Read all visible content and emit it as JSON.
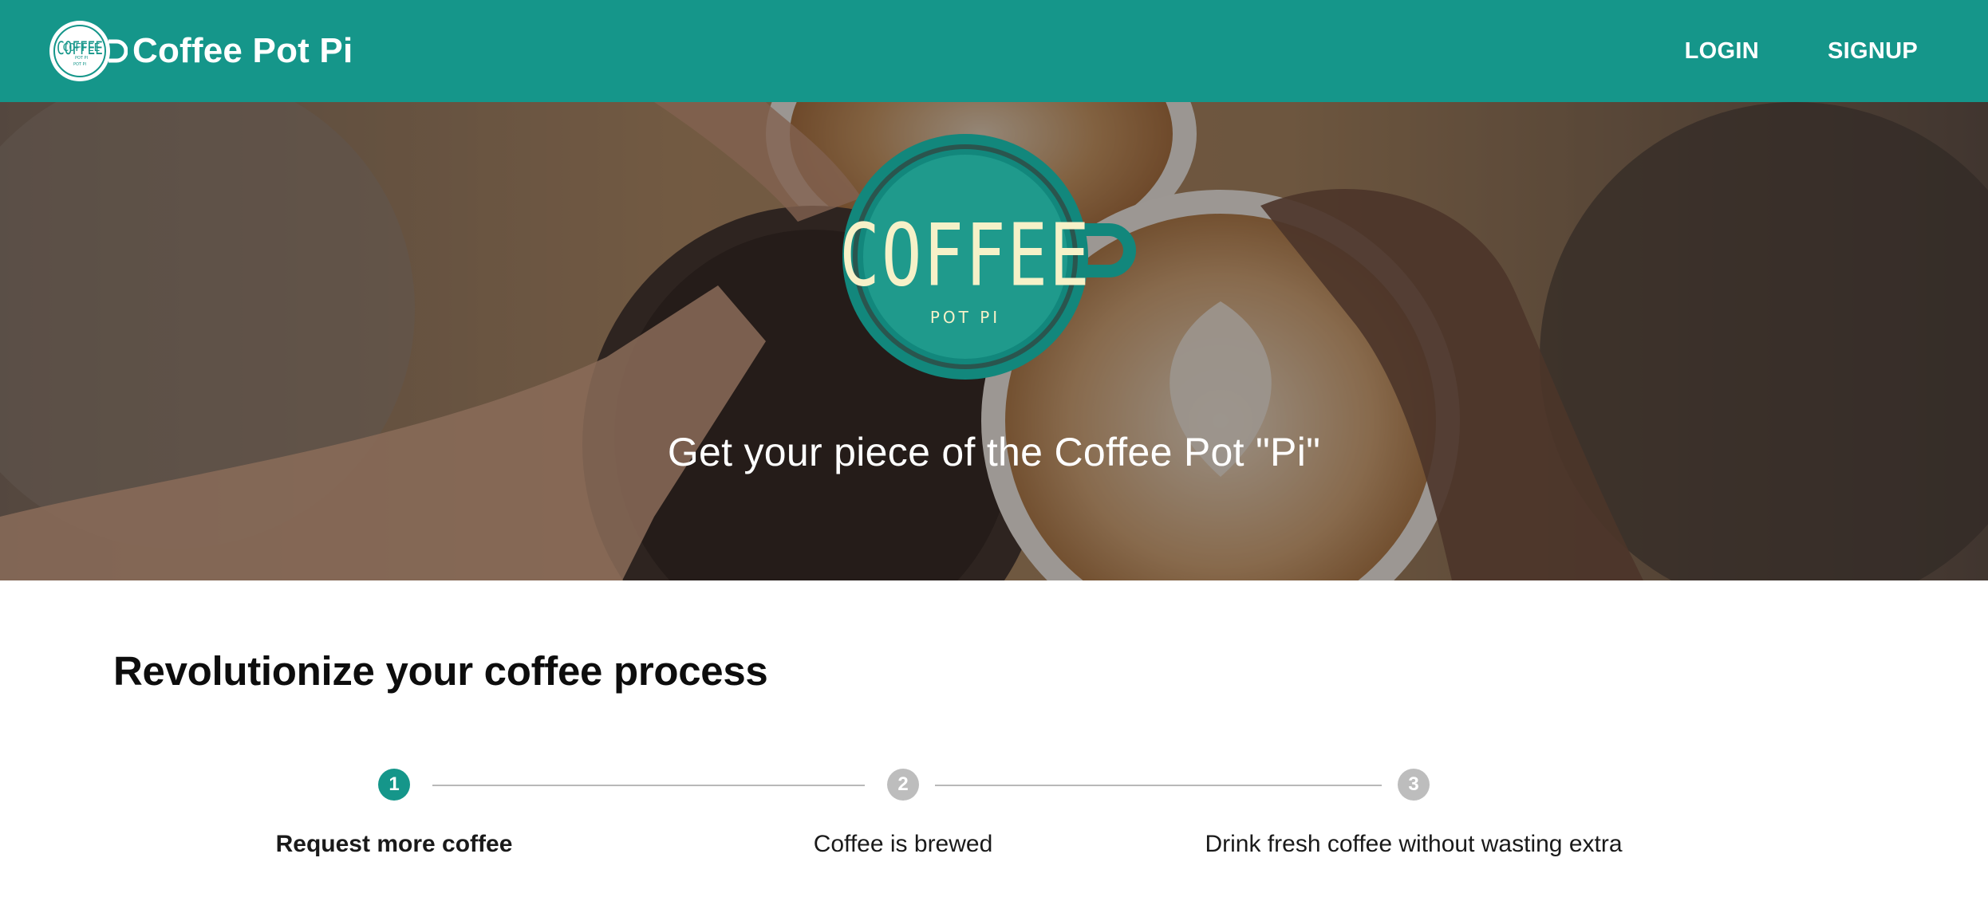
{
  "header": {
    "brand_name": "Coffee Pot Pi",
    "logo_text": "COFFEE",
    "logo_subtext": "POT PI",
    "nav": [
      {
        "label": "LOGIN"
      },
      {
        "label": "SIGNUP"
      }
    ]
  },
  "hero": {
    "logo_text": "COFFEE",
    "logo_subtext": "POT PI",
    "tagline": "Get your piece of the Coffee Pot \"Pi\""
  },
  "main": {
    "section_title": "Revolutionize your coffee process",
    "steps": [
      {
        "number": "1",
        "label": "Request more coffee",
        "state": "active"
      },
      {
        "number": "2",
        "label": "Coffee is brewed",
        "state": "inactive"
      },
      {
        "number": "3",
        "label": "Drink fresh coffee without wasting extra",
        "state": "inactive"
      }
    ]
  },
  "colors": {
    "brand_teal": "#15968a",
    "step_inactive": "#bdbdbd",
    "logo_cream": "#f6f1c8"
  }
}
